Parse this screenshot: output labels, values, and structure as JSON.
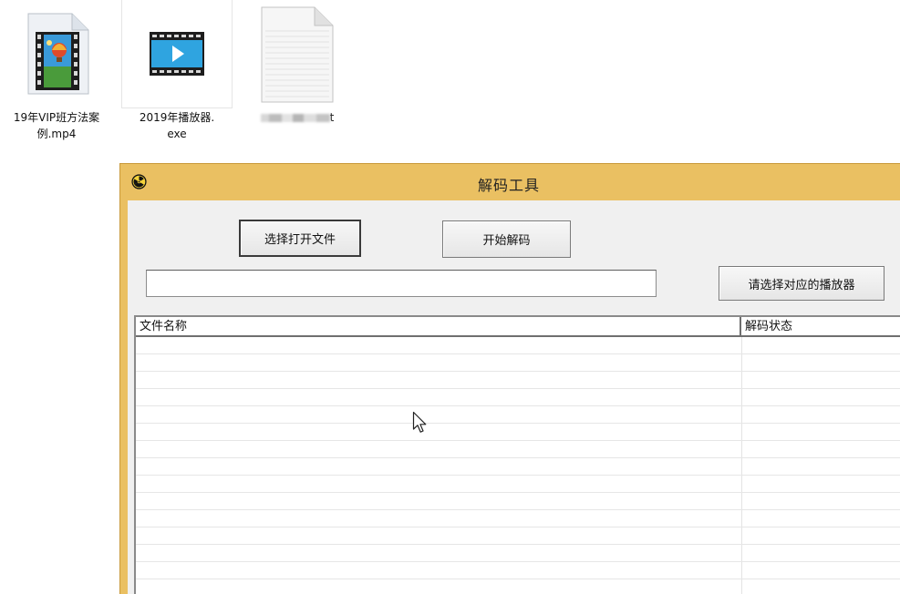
{
  "desktop": {
    "files": [
      {
        "name_line1": "19年VIP班方法案",
        "name_line2": "例.mp4",
        "icon": "video-file-icon",
        "selected": false
      },
      {
        "name_line1": "2019年播放器.",
        "name_line2": "exe",
        "icon": "player-exe-icon",
        "selected": true
      },
      {
        "name_suffix": "t",
        "icon": "text-file-icon",
        "selected": false
      }
    ]
  },
  "window": {
    "title": "解码工具",
    "app_icon": "radiation-icon",
    "buttons": {
      "open_file": "选择打开文件",
      "start_decode": "开始解码",
      "choose_player": "请选择对应的播放器"
    },
    "path_input": {
      "value": "",
      "placeholder": ""
    },
    "list": {
      "columns": [
        "文件名称",
        "解码状态"
      ],
      "rows": []
    }
  },
  "colors": {
    "window_frame": "#eac062",
    "client_bg": "#f0f0f0",
    "list_bg": "#ffffff"
  }
}
